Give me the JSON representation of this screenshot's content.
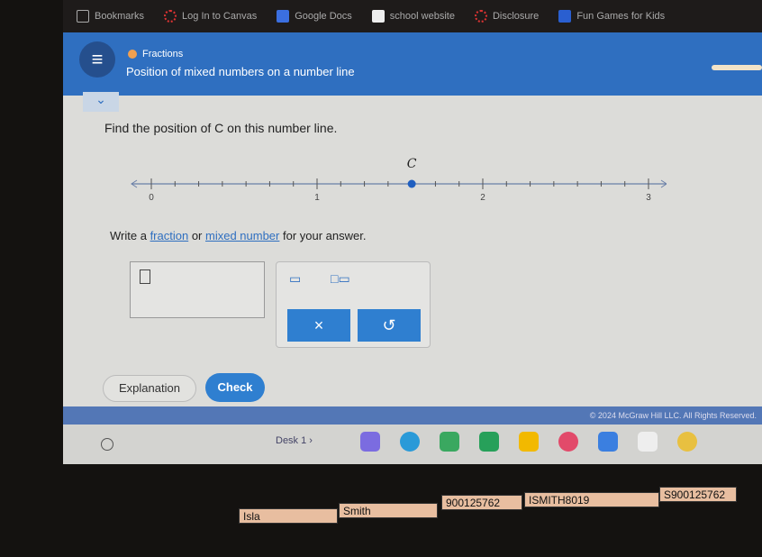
{
  "bookmarks": [
    {
      "label": "Bookmarks",
      "icon": "folder-icon"
    },
    {
      "label": "Log In to Canvas",
      "icon": "canvas-icon"
    },
    {
      "label": "Google Docs",
      "icon": "docs-icon"
    },
    {
      "label": "school website",
      "icon": "school-icon"
    },
    {
      "label": "Disclosure",
      "icon": "canvas-icon"
    },
    {
      "label": "Fun Games for Kids",
      "icon": "mp-icon"
    }
  ],
  "header": {
    "topic": "Fractions",
    "title": "Position of mixed numbers on a number line",
    "accent": "#2f6fc0"
  },
  "question": {
    "prompt": "Find the position of C on this number line.",
    "point_label": "C",
    "point_value": "1 4/7",
    "axis_labels": [
      "0",
      "1",
      "2",
      "3"
    ],
    "subdivisions_per_unit": 7,
    "instruction_parts": [
      "Write a ",
      "fraction",
      " or ",
      "mixed number",
      " for your answer."
    ]
  },
  "answer": {
    "value": ""
  },
  "keypad": {
    "fraction_icon": "fraction-icon",
    "mixed_icon": "mixed-number-icon",
    "clear": "×",
    "undo": "↺"
  },
  "buttons": {
    "explanation": "Explanation",
    "check": "Check"
  },
  "footer": {
    "copyright": "© 2024 McGraw Hill LLC. All Rights Reserved."
  },
  "shelf": {
    "desk": "Desk 1",
    "apps": [
      "tasks",
      "classroom-screen",
      "drive",
      "sheets",
      "slides",
      "paint",
      "docs",
      "gmail",
      "chrome"
    ]
  },
  "sticker_labels": [
    "Isla",
    "Smith",
    "900125762",
    "ISMITH8019",
    "S900125762"
  ]
}
